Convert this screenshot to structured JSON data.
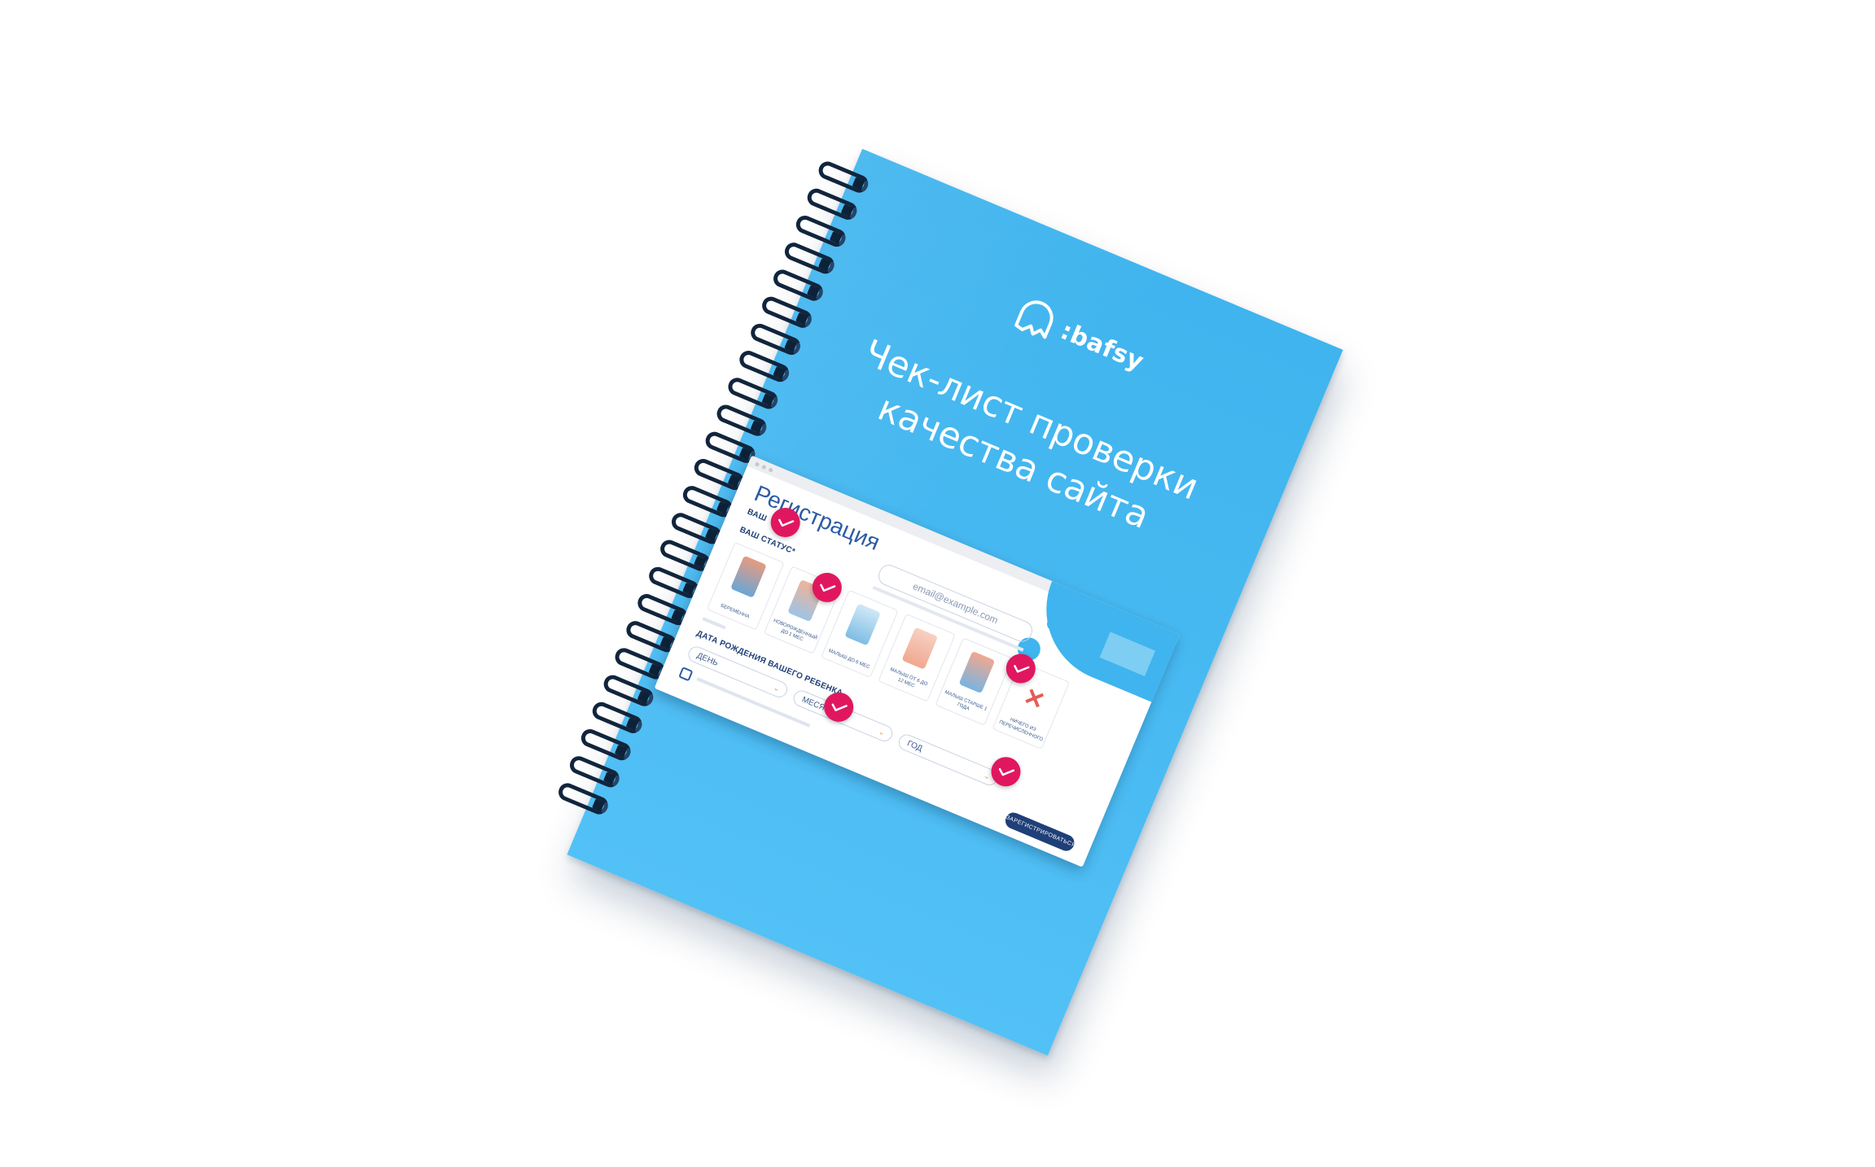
{
  "brand": {
    "name": ":bafsy",
    "logo_icon": "bafsy-speech-bubble-icon"
  },
  "cover": {
    "title_lines": [
      "Чек-лист проверки",
      "качества сайта"
    ],
    "color": "#46b8f0",
    "spiral_color": "#11253c"
  },
  "screenshot": {
    "heading": "Регистрация",
    "labels": {
      "your": "ВАШ",
      "status": "ВАШ СТАТУС*",
      "birth_date": "ДАТА РОЖДЕНИЯ ВАШЕГО РЕБЕНКА"
    },
    "email_placeholder": "email@example.com",
    "cards": [
      {
        "caption": "БЕРЕМЕННА"
      },
      {
        "caption": "НОВОРОЖДЕННЫЙ ДО 1 МЕС"
      },
      {
        "caption": "МАЛЫШ ДО 6 МЕС"
      },
      {
        "caption": "МАЛЫШ ОТ 6 ДО 12 МЕС"
      },
      {
        "caption": "МАЛЫШ СТАРШЕ 1 ГОДА"
      },
      {
        "caption": "НИЧЕГО ИЗ ПЕРЕЧИСЛЕННОГО"
      }
    ],
    "selects": {
      "day": "ДЕНЬ",
      "month": "МЕСЯЦ",
      "year": "ГОД"
    },
    "submit": "ЗАРЕГИСТРИРОВАТЬСЯ",
    "check_color": "#e0175f"
  }
}
